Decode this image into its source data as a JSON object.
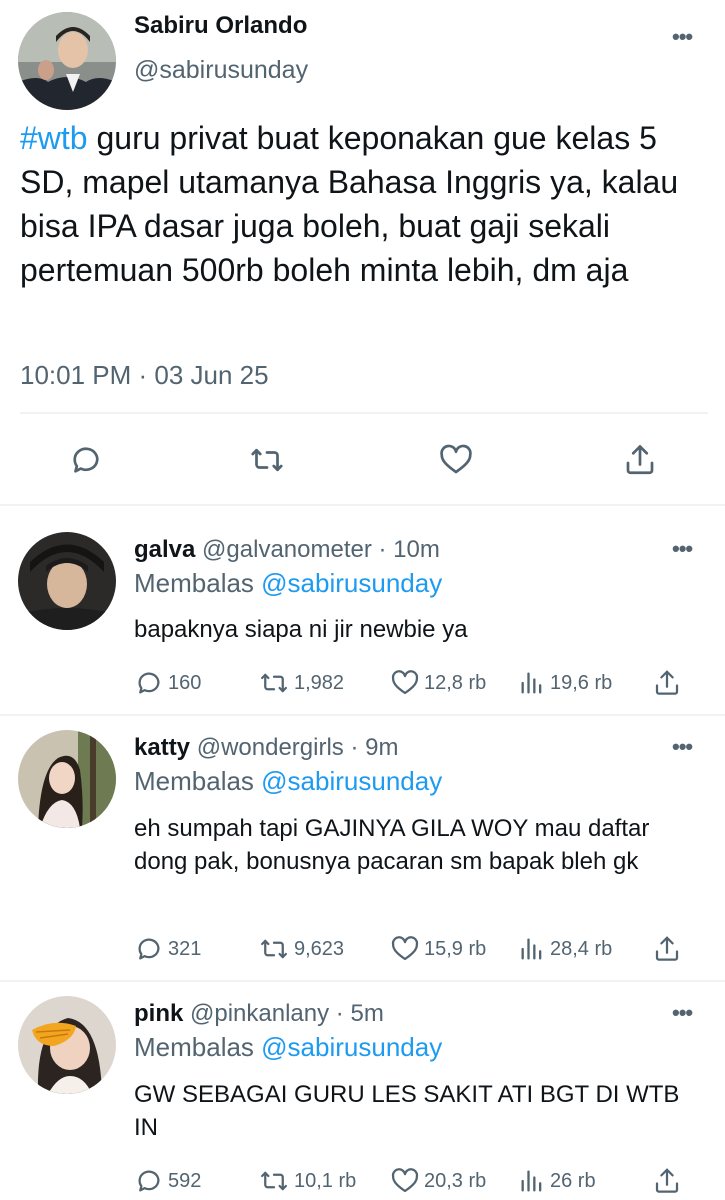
{
  "main_tweet": {
    "display_name": "Sabiru Orlando",
    "handle": "@sabirusunday",
    "hashtag": "#wtb",
    "text": " guru privat buat keponakan gue kelas 5 SD, mapel utamanya Bahasa Inggris ya, kalau bisa IPA dasar juga boleh, buat gaji sekali pertemuan 500rb boleh minta lebih, dm aja",
    "timestamp": "10:01 PM · 03 Jun 25",
    "more": "•••"
  },
  "replies": [
    {
      "display_name": "galva",
      "handle": "@galvanometer",
      "age": " · 10m",
      "reply_prefix": "Membalas ",
      "reply_to": "@sabirusunday",
      "text": "bapaknya siapa ni jir newbie ya",
      "counts": {
        "replies": "160",
        "retweets": "1,982",
        "likes": "12,8 rb",
        "views": "19,6 rb"
      }
    },
    {
      "display_name": "katty",
      "handle": "@wondergirls",
      "age": " · 9m",
      "reply_prefix": "Membalas ",
      "reply_to": "@sabirusunday",
      "text": "eh sumpah tapi GAJINYA GILA WOY mau daftar dong pak, bonusnya pacaran sm bapak bleh gk",
      "counts": {
        "replies": "321",
        "retweets": "9,623",
        "likes": "15,9 rb",
        "views": "28,4 rb"
      }
    },
    {
      "display_name": "pink",
      "handle": "@pinkanlany",
      "age": " · 5m",
      "reply_prefix": "Membalas ",
      "reply_to": "@sabirusunday",
      "text": "GW SEBAGAI GURU LES SAKIT ATI BGT DI WTB IN",
      "counts": {
        "replies": "592",
        "retweets": "10,1 rb",
        "likes": "20,3 rb",
        "views": "26 rb"
      }
    }
  ],
  "colors": {
    "accent": "#1d9bf0",
    "secondary_text": "#536471",
    "divider": "#eff3f4"
  }
}
